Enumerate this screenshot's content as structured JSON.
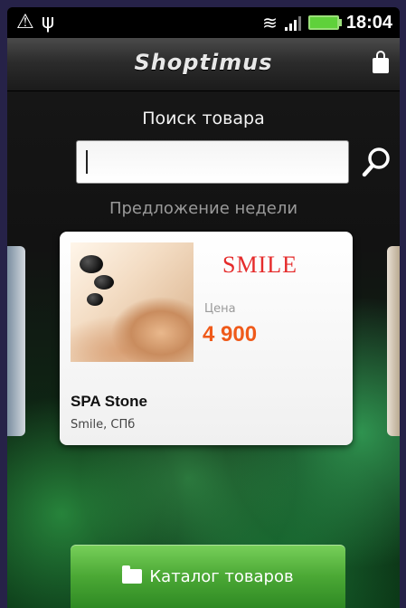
{
  "status_bar": {
    "time": "18:04",
    "icons": [
      "warning-icon",
      "usb-icon",
      "wifi-icon",
      "signal-icon",
      "battery-icon"
    ]
  },
  "title_bar": {
    "app_name": "Shoptimus",
    "cart_icon": "shopping-bag-icon"
  },
  "search": {
    "label": "Поиск товара",
    "value": "",
    "search_icon": "magnifier-icon"
  },
  "offer_section": {
    "label": "Предложение недели"
  },
  "offer_card": {
    "partner_logo_text": "SMILE",
    "price_caption": "Цена",
    "price": "4 900",
    "name": "SPA Stone",
    "subtitle": "Smile, СПб"
  },
  "catalog_button": {
    "label": "Каталог товаров",
    "icon": "folder-icon"
  },
  "colors": {
    "accent_green": "#4ba835",
    "price_orange": "#ef5a1a",
    "logo_red": "#e52b2b"
  }
}
